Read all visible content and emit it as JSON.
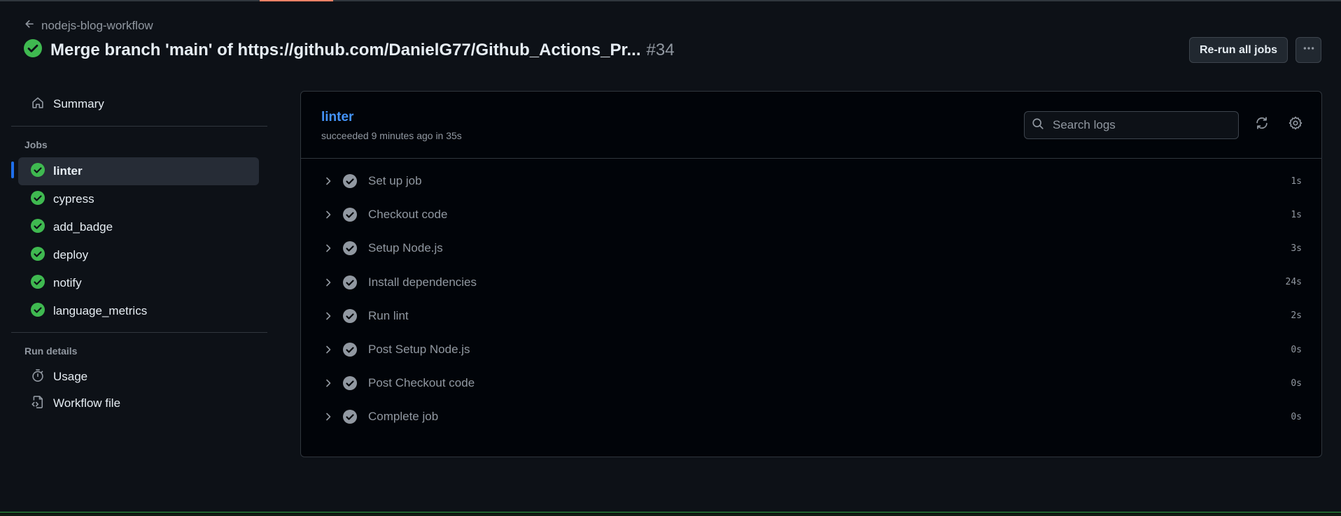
{
  "header": {
    "back_label": "nodejs-blog-workflow",
    "title": "Merge branch 'main' of https://github.com/DanielG77/Github_Actions_Pr...",
    "run_number": "#34",
    "rerun_label": "Re-run all jobs"
  },
  "sidebar": {
    "summary_label": "Summary",
    "jobs_heading": "Jobs",
    "jobs": [
      {
        "label": "linter",
        "active": true
      },
      {
        "label": "cypress",
        "active": false
      },
      {
        "label": "add_badge",
        "active": false
      },
      {
        "label": "deploy",
        "active": false
      },
      {
        "label": "notify",
        "active": false
      },
      {
        "label": "language_metrics",
        "active": false
      }
    ],
    "run_details_heading": "Run details",
    "usage_label": "Usage",
    "workflow_file_label": "Workflow file"
  },
  "job": {
    "name": "linter",
    "status_text": "succeeded 9 minutes ago in 35s",
    "search_placeholder": "Search logs",
    "steps": [
      {
        "name": "Set up job",
        "duration": "1s"
      },
      {
        "name": "Checkout code",
        "duration": "1s"
      },
      {
        "name": "Setup Node.js",
        "duration": "3s"
      },
      {
        "name": "Install dependencies",
        "duration": "24s"
      },
      {
        "name": "Run lint",
        "duration": "2s"
      },
      {
        "name": "Post Setup Node.js",
        "duration": "0s"
      },
      {
        "name": "Post Checkout code",
        "duration": "0s"
      },
      {
        "name": "Complete job",
        "duration": "0s"
      }
    ]
  },
  "colors": {
    "success": "#3fb950",
    "link": "#4493f8",
    "active_indicator": "#1f6feb",
    "step_check": "#9198a1"
  },
  "icons": [
    "arrow-left-icon",
    "check-circle-icon",
    "kebab-horizontal-icon",
    "home-icon",
    "stopwatch-icon",
    "file-code-icon",
    "search-icon",
    "sync-icon",
    "gear-icon",
    "chevron-right-icon"
  ]
}
